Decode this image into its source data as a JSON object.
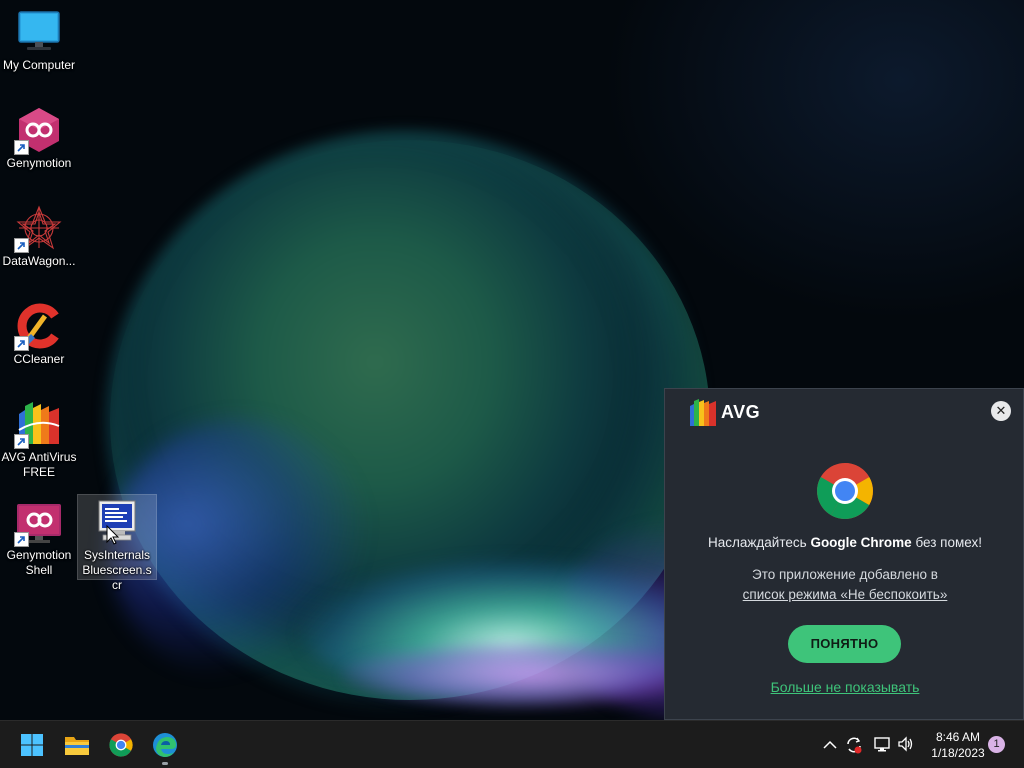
{
  "desktop": {
    "icons": [
      {
        "label": "My Computer"
      },
      {
        "label": "Genymotion"
      },
      {
        "label": "DataWagon..."
      },
      {
        "label": "CCleaner"
      },
      {
        "label": "AVG AntiVirus FREE"
      },
      {
        "label": "Genymotion Shell"
      },
      {
        "label": "SysInternalsBluescreen.scr"
      }
    ]
  },
  "avg_popup": {
    "brand": "AVG",
    "close_icon": "close-icon",
    "headline_prefix": "Наслаждайтесь ",
    "headline_bold": "Google Chrome",
    "headline_suffix": " без помех!",
    "desc_line1": "Это приложение добавлено в",
    "desc_link": "список режима «Не беспокоить»",
    "ok_button": "ПОНЯТНО",
    "dismiss_link": "Больше не показывать",
    "accent_color": "#3ec47a"
  },
  "taskbar": {
    "apps": [
      "windows-start-icon",
      "file-explorer-icon",
      "chrome-icon",
      "edge-icon"
    ],
    "tray": [
      "chevron-up-icon",
      "avg-sync-icon",
      "network-icon",
      "volume-icon"
    ],
    "time": "8:46 AM",
    "date": "1/18/2023",
    "notification_count": "1"
  }
}
